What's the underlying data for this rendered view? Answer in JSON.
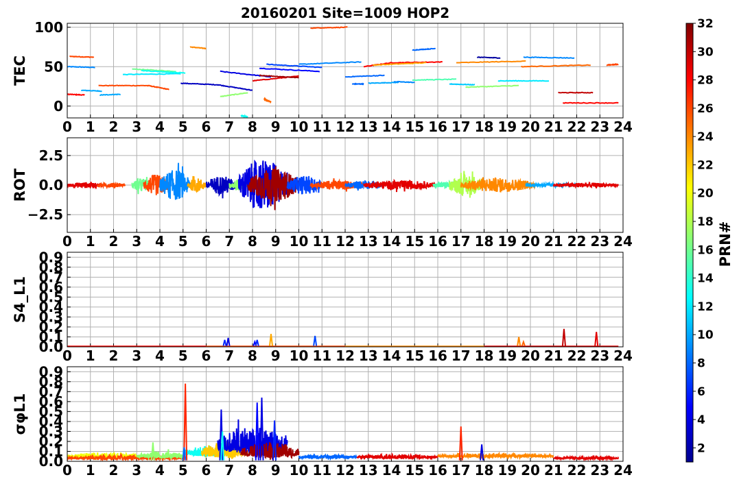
{
  "figure": {
    "title": "20160201 Site=1009 HOP2"
  },
  "colorbar": {
    "label": "PRN#",
    "min": 1,
    "max": 32,
    "ticks": [
      "2",
      "4",
      "6",
      "8",
      "10",
      "12",
      "14",
      "16",
      "18",
      "20",
      "22",
      "24",
      "26",
      "28",
      "30",
      "32"
    ],
    "colormap": "jet"
  },
  "chart_data": [
    {
      "type": "line",
      "panel": "TEC",
      "ylabel": "TEC",
      "xlim": [
        0,
        24
      ],
      "ylim": [
        -15,
        105
      ],
      "xticks": [
        "0",
        "1",
        "2",
        "3",
        "4",
        "5",
        "6",
        "7",
        "8",
        "9",
        "10",
        "11",
        "12",
        "13",
        "14",
        "15",
        "16",
        "17",
        "18",
        "19",
        "20",
        "21",
        "22",
        "23",
        "24"
      ],
      "yticks": [
        "0",
        "50",
        "100"
      ],
      "grid": true,
      "series": [
        {
          "prn": 9,
          "x": [
            0.0,
            1.2
          ],
          "y": [
            50,
            49
          ]
        },
        {
          "prn": 26,
          "x": [
            0.1,
            1.15
          ],
          "y": [
            63,
            62
          ]
        },
        {
          "prn": 28,
          "x": [
            0.0,
            0.75
          ],
          "y": [
            15,
            14
          ]
        },
        {
          "prn": 10,
          "x": [
            0.6,
            1.5
          ],
          "y": [
            20,
            19
          ]
        },
        {
          "prn": 26,
          "x": [
            1.35,
            3.5,
            4.4
          ],
          "y": [
            26,
            26,
            21
          ]
        },
        {
          "prn": 10,
          "x": [
            1.4,
            2.3
          ],
          "y": [
            14,
            15
          ]
        },
        {
          "prn": 12,
          "x": [
            2.4,
            4.9
          ],
          "y": [
            40,
            41
          ]
        },
        {
          "prn": 16,
          "x": [
            2.8,
            4.7
          ],
          "y": [
            47,
            44
          ]
        },
        {
          "prn": 13,
          "x": [
            3.2,
            5.1
          ],
          "y": [
            45,
            42
          ]
        },
        {
          "prn": 24,
          "x": [
            5.3,
            6.0
          ],
          "y": [
            75,
            73
          ]
        },
        {
          "prn": 3,
          "x": [
            4.9,
            6.5,
            8.0
          ],
          "y": [
            29,
            27,
            20
          ]
        },
        {
          "prn": 17,
          "x": [
            6.6,
            7.8
          ],
          "y": [
            12,
            17
          ]
        },
        {
          "prn": 13,
          "x": [
            7.5,
            7.8
          ],
          "y": [
            -12,
            -14
          ]
        },
        {
          "prn": 4,
          "x": [
            6.6,
            8.8
          ],
          "y": [
            44,
            37
          ]
        },
        {
          "prn": 29,
          "x": [
            8.0,
            10.0
          ],
          "y": [
            32,
            38
          ]
        },
        {
          "prn": 31,
          "x": [
            8.3,
            10.0
          ],
          "y": [
            39,
            36
          ]
        },
        {
          "prn": 25,
          "x": [
            8.5,
            8.8
          ],
          "y": [
            9,
            5
          ]
        },
        {
          "prn": 5,
          "x": [
            8.3,
            10.9
          ],
          "y": [
            48,
            44
          ]
        },
        {
          "prn": 7,
          "x": [
            8.6,
            11.0
          ],
          "y": [
            53,
            49
          ]
        },
        {
          "prn": 26,
          "x": [
            10.5,
            12.1
          ],
          "y": [
            99,
            100
          ]
        },
        {
          "prn": 9,
          "x": [
            10.0,
            12.7
          ],
          "y": [
            53,
            56
          ]
        },
        {
          "prn": 8,
          "x": [
            12.0,
            13.7
          ],
          "y": [
            37,
            39
          ]
        },
        {
          "prn": 8,
          "x": [
            12.3,
            12.8
          ],
          "y": [
            28,
            28
          ]
        },
        {
          "prn": 10,
          "x": [
            13.0,
            14.3
          ],
          "y": [
            29,
            30
          ]
        },
        {
          "prn": 9,
          "x": [
            14.1,
            15.0
          ],
          "y": [
            31,
            30
          ]
        },
        {
          "prn": 28,
          "x": [
            12.8,
            14.0,
            16.2
          ],
          "y": [
            50,
            55,
            56
          ]
        },
        {
          "prn": 23,
          "x": [
            13.2,
            15.5
          ],
          "y": [
            52,
            55
          ]
        },
        {
          "prn": 8,
          "x": [
            14.9,
            15.9
          ],
          "y": [
            71,
            73
          ]
        },
        {
          "prn": 15,
          "x": [
            14.9,
            16.8
          ],
          "y": [
            33,
            34
          ]
        },
        {
          "prn": 11,
          "x": [
            16.5,
            17.6
          ],
          "y": [
            28,
            27
          ]
        },
        {
          "prn": 17,
          "x": [
            17.2,
            19.5
          ],
          "y": [
            24,
            26
          ]
        },
        {
          "prn": 24,
          "x": [
            16.8,
            19.8
          ],
          "y": [
            55,
            57
          ]
        },
        {
          "prn": 2,
          "x": [
            17.7,
            18.7
          ],
          "y": [
            62,
            61
          ]
        },
        {
          "prn": 12,
          "x": [
            18.6,
            20.8
          ],
          "y": [
            32,
            32
          ]
        },
        {
          "prn": 9,
          "x": [
            19.7,
            21.9
          ],
          "y": [
            62,
            61
          ]
        },
        {
          "prn": 25,
          "x": [
            19.6,
            22.6
          ],
          "y": [
            50,
            52
          ]
        },
        {
          "prn": 30,
          "x": [
            21.2,
            22.7
          ],
          "y": [
            17,
            17
          ]
        },
        {
          "prn": 28,
          "x": [
            21.4,
            23.8
          ],
          "y": [
            4,
            4
          ]
        },
        {
          "prn": 26,
          "x": [
            23.3,
            23.8
          ],
          "y": [
            52,
            53
          ]
        }
      ]
    },
    {
      "type": "line",
      "panel": "ROT",
      "ylabel": "ROT",
      "xlim": [
        0,
        24
      ],
      "ylim": [
        -4,
        4
      ],
      "xticks": [
        "0",
        "1",
        "2",
        "3",
        "4",
        "5",
        "6",
        "7",
        "8",
        "9",
        "10",
        "11",
        "12",
        "13",
        "14",
        "15",
        "16",
        "17",
        "18",
        "19",
        "20",
        "21",
        "22",
        "23",
        "24"
      ],
      "yticks": [
        "2.5",
        "0.0",
        "−2.5"
      ],
      "grid": true,
      "noise_bands": [
        {
          "prn": 29,
          "x": [
            0,
            1.5
          ],
          "amp": 0.25
        },
        {
          "prn": 26,
          "x": [
            1.3,
            2.5
          ],
          "amp": 0.2
        },
        {
          "prn": 16,
          "x": [
            2.8,
            3.6
          ],
          "amp": 0.6
        },
        {
          "prn": 26,
          "x": [
            3.3,
            4.4
          ],
          "amp": 0.9
        },
        {
          "prn": 9,
          "x": [
            4.0,
            5.3
          ],
          "amp": 1.3
        },
        {
          "prn": 23,
          "x": [
            5.2,
            6.0
          ],
          "amp": 0.6
        },
        {
          "prn": 3,
          "x": [
            6.0,
            7.3
          ],
          "amp": 0.8
        },
        {
          "prn": 17,
          "x": [
            7.0,
            7.8
          ],
          "amp": 0.5
        },
        {
          "prn": 4,
          "x": [
            7.4,
            9.5
          ],
          "amp": 2.2
        },
        {
          "prn": 31,
          "x": [
            7.8,
            10.0
          ],
          "amp": 1.4
        },
        {
          "prn": 7,
          "x": [
            9.5,
            11.0
          ],
          "amp": 0.8
        },
        {
          "prn": 26,
          "x": [
            10.5,
            12.8
          ],
          "amp": 0.4
        },
        {
          "prn": 8,
          "x": [
            12.0,
            13.6
          ],
          "amp": 0.35
        },
        {
          "prn": 29,
          "x": [
            12.8,
            16.0
          ],
          "amp": 0.4
        },
        {
          "prn": 15,
          "x": [
            15.8,
            17.2
          ],
          "amp": 0.3
        },
        {
          "prn": 18,
          "x": [
            16.5,
            18.0
          ],
          "amp": 0.9
        },
        {
          "prn": 24,
          "x": [
            17.0,
            20.2
          ],
          "amp": 0.6
        },
        {
          "prn": 10,
          "x": [
            19.8,
            22.0
          ],
          "amp": 0.15
        },
        {
          "prn": 29,
          "x": [
            21.0,
            23.8
          ],
          "amp": 0.2
        }
      ]
    },
    {
      "type": "line",
      "panel": "S4_L1",
      "ylabel": "S4_L1",
      "xlim": [
        0,
        24
      ],
      "ylim": [
        0,
        0.95
      ],
      "xticks": [
        "0",
        "1",
        "2",
        "3",
        "4",
        "5",
        "6",
        "7",
        "8",
        "9",
        "10",
        "11",
        "12",
        "13",
        "14",
        "15",
        "16",
        "17",
        "18",
        "19",
        "20",
        "21",
        "22",
        "23",
        "24"
      ],
      "yticks": [
        "0.0",
        "0.1",
        "0.2",
        "0.3",
        "0.4",
        "0.5",
        "0.6",
        "0.7",
        "0.8",
        "0.9"
      ],
      "grid": true,
      "baseline_series": [
        {
          "prn": 28,
          "x": [
            0,
            6.0
          ],
          "y": [
            0.005,
            0.005
          ]
        },
        {
          "prn": 26,
          "x": [
            6.0,
            12.0
          ],
          "y": [
            0.005,
            0.005
          ]
        },
        {
          "prn": 24,
          "x": [
            12.0,
            18.0
          ],
          "y": [
            0.005,
            0.005
          ]
        },
        {
          "prn": 29,
          "x": [
            18.0,
            23.8
          ],
          "y": [
            0.005,
            0.005
          ]
        }
      ],
      "spikes": [
        {
          "prn": 6,
          "x": 6.8,
          "y": 0.07
        },
        {
          "prn": 4,
          "x": 6.95,
          "y": 0.09
        },
        {
          "prn": 5,
          "x": 8.1,
          "y": 0.05
        },
        {
          "prn": 6,
          "x": 8.2,
          "y": 0.07
        },
        {
          "prn": 23,
          "x": 8.8,
          "y": 0.13
        },
        {
          "prn": 7,
          "x": 10.7,
          "y": 0.11
        },
        {
          "prn": 24,
          "x": 19.5,
          "y": 0.1
        },
        {
          "prn": 25,
          "x": 19.7,
          "y": 0.05
        },
        {
          "prn": 30,
          "x": 21.45,
          "y": 0.18
        },
        {
          "prn": 29,
          "x": 22.85,
          "y": 0.15
        }
      ]
    },
    {
      "type": "line",
      "panel": "sigma_phi_L1",
      "ylabel": "σφL1",
      "xlim": [
        0,
        24
      ],
      "ylim": [
        0,
        0.95
      ],
      "xticks": [
        "0",
        "1",
        "2",
        "3",
        "4",
        "5",
        "6",
        "7",
        "8",
        "9",
        "10",
        "11",
        "12",
        "13",
        "14",
        "15",
        "16",
        "17",
        "18",
        "19",
        "20",
        "21",
        "22",
        "23",
        "24"
      ],
      "yticks": [
        "0.0",
        "0.1",
        "0.2",
        "0.3",
        "0.4",
        "0.5",
        "0.6",
        "0.7",
        "0.8",
        "0.9"
      ],
      "grid": true,
      "noise_bands": [
        {
          "prn": 20,
          "x": [
            0,
            3.0
          ],
          "base": 0.05,
          "amp": 0.04
        },
        {
          "prn": 26,
          "x": [
            0,
            5.0
          ],
          "base": 0.03,
          "amp": 0.03
        },
        {
          "prn": 17,
          "x": [
            3.0,
            5.0
          ],
          "base": 0.05,
          "amp": 0.05
        },
        {
          "prn": 13,
          "x": [
            5.0,
            7.0
          ],
          "base": 0.08,
          "amp": 0.08
        },
        {
          "prn": 22,
          "x": [
            5.8,
            7.8
          ],
          "base": 0.08,
          "amp": 0.12
        },
        {
          "prn": 4,
          "x": [
            6.5,
            9.5
          ],
          "base": 0.15,
          "amp": 0.2
        },
        {
          "prn": 31,
          "x": [
            7.5,
            10.0
          ],
          "base": 0.08,
          "amp": 0.12
        },
        {
          "prn": 8,
          "x": [
            10.0,
            12.5
          ],
          "base": 0.04,
          "amp": 0.03
        },
        {
          "prn": 29,
          "x": [
            12.5,
            16.0
          ],
          "base": 0.04,
          "amp": 0.03
        },
        {
          "prn": 24,
          "x": [
            16.0,
            21.0
          ],
          "base": 0.05,
          "amp": 0.03
        },
        {
          "prn": 29,
          "x": [
            21.0,
            23.8
          ],
          "base": 0.03,
          "amp": 0.02
        }
      ],
      "spikes": [
        {
          "prn": 27,
          "x": 5.1,
          "y": 0.78
        },
        {
          "prn": 8,
          "x": 5.05,
          "y": 0.14
        },
        {
          "prn": 17,
          "x": 3.7,
          "y": 0.19
        },
        {
          "prn": 4,
          "x": 6.65,
          "y": 0.52
        },
        {
          "prn": 13,
          "x": 6.7,
          "y": 0.3
        },
        {
          "prn": 5,
          "x": 8.2,
          "y": 0.59
        },
        {
          "prn": 4,
          "x": 8.4,
          "y": 0.64
        },
        {
          "prn": 6,
          "x": 8.95,
          "y": 0.41
        },
        {
          "prn": 27,
          "x": 17.0,
          "y": 0.35
        },
        {
          "prn": 4,
          "x": 17.9,
          "y": 0.17
        }
      ]
    }
  ]
}
